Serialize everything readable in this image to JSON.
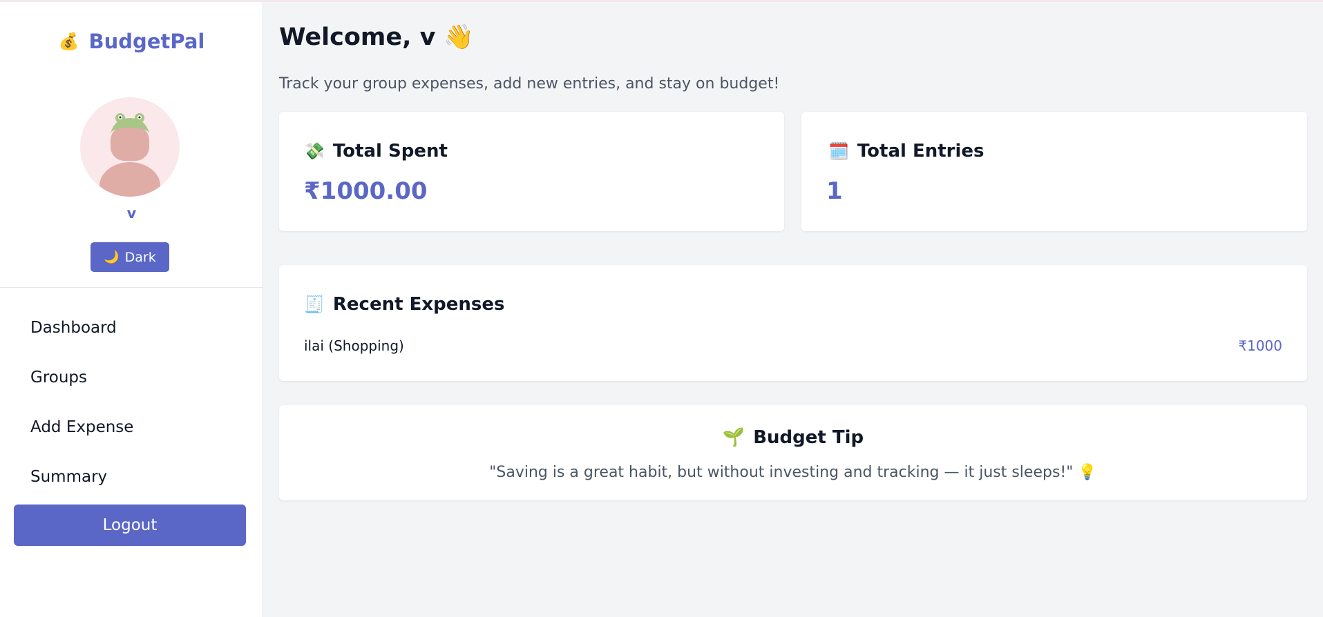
{
  "brand": {
    "icon": "💰",
    "name": "BudgetPal"
  },
  "user": {
    "name": "v",
    "avatar_icon": "frog-hat-avatar-icon"
  },
  "theme_toggle": {
    "icon": "🌙",
    "label": "Dark"
  },
  "nav": [
    {
      "label": "Dashboard"
    },
    {
      "label": "Groups"
    },
    {
      "label": "Add Expense"
    },
    {
      "label": "Summary"
    }
  ],
  "logout_label": "Logout",
  "header": {
    "welcome": "Welcome, v",
    "wave": "👋",
    "subtitle": "Track your group expenses, add new entries, and stay on budget!"
  },
  "stats": {
    "total_spent": {
      "icon": "💸",
      "label": "Total Spent",
      "value": "₹1000.00"
    },
    "total_entries": {
      "icon": "🗓️",
      "label": "Total Entries",
      "value": "1"
    }
  },
  "recent": {
    "icon": "🧾",
    "title": "Recent Expenses",
    "items": [
      {
        "name": "ilai (Shopping)",
        "amount": "₹1000"
      }
    ]
  },
  "tip": {
    "icon": "🌱",
    "title": "Budget Tip",
    "text": "\"Saving is a great habit, but without investing and tracking — it just sleeps!\" 💡"
  },
  "colors": {
    "accent": "#5a67c7",
    "background": "#f3f4f6",
    "card": "#ffffff",
    "text": "#111827",
    "muted": "#4b5563"
  }
}
